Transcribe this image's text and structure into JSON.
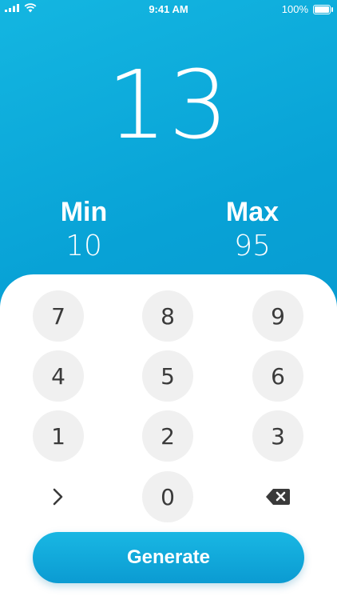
{
  "status_bar": {
    "time": "9:41 AM",
    "battery": "100%"
  },
  "result": "13",
  "range": {
    "min_label": "Min",
    "min_value": "10",
    "max_label": "Max",
    "max_value": "95"
  },
  "keypad": {
    "keys": [
      "7",
      "8",
      "9",
      "4",
      "5",
      "6",
      "1",
      "2",
      "3",
      "0"
    ]
  },
  "generate_label": "Generate",
  "colors": {
    "accent": "#0ea5dc",
    "key_bg": "#f0f0f0"
  }
}
